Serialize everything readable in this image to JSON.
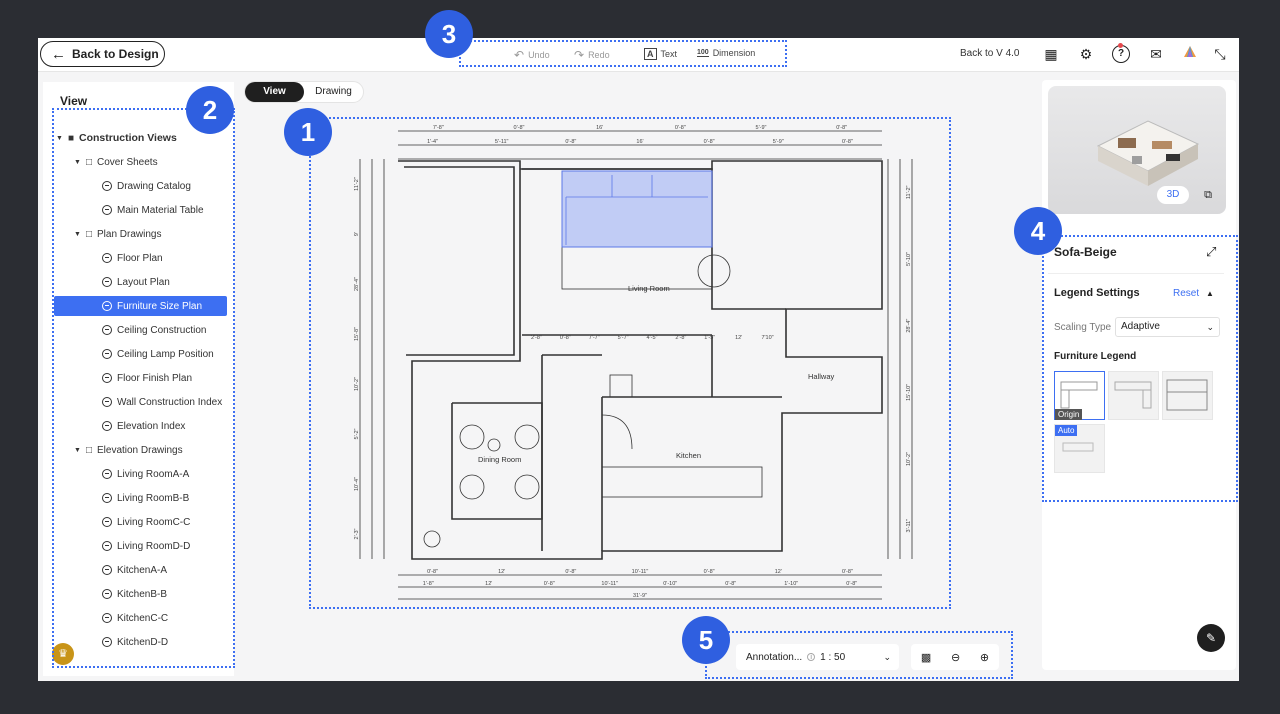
{
  "topbar": {
    "back_label": "Back to Design",
    "undo": "Undo",
    "redo": "Redo",
    "text": "Text",
    "dimension": "Dimension",
    "dimension_glyph": "100",
    "back_version": "Back to V 4.0"
  },
  "left_panel": {
    "title": "View",
    "tree": [
      {
        "label": "Construction Views",
        "level": 0,
        "kind": "root"
      },
      {
        "label": "Cover Sheets",
        "level": 1,
        "kind": "folder"
      },
      {
        "label": "Drawing Catalog",
        "level": 2,
        "kind": "leaf"
      },
      {
        "label": "Main Material Table",
        "level": 2,
        "kind": "leaf"
      },
      {
        "label": "Plan Drawings",
        "level": 1,
        "kind": "folder"
      },
      {
        "label": "Floor Plan",
        "level": 2,
        "kind": "leaf"
      },
      {
        "label": "Layout Plan",
        "level": 2,
        "kind": "leaf"
      },
      {
        "label": "Furniture Size Plan",
        "level": 2,
        "kind": "leaf",
        "selected": true
      },
      {
        "label": "Ceiling Construction",
        "level": 2,
        "kind": "leaf"
      },
      {
        "label": "Ceiling Lamp Position",
        "level": 2,
        "kind": "leaf"
      },
      {
        "label": "Floor Finish Plan",
        "level": 2,
        "kind": "leaf"
      },
      {
        "label": "Wall Construction Index",
        "level": 2,
        "kind": "leaf"
      },
      {
        "label": "Elevation Index",
        "level": 2,
        "kind": "leaf"
      },
      {
        "label": "Elevation Drawings",
        "level": 1,
        "kind": "folder"
      },
      {
        "label": "Living RoomA-A",
        "level": 2,
        "kind": "leaf"
      },
      {
        "label": "Living RoomB-B",
        "level": 2,
        "kind": "leaf"
      },
      {
        "label": "Living RoomC-C",
        "level": 2,
        "kind": "leaf"
      },
      {
        "label": "Living RoomD-D",
        "level": 2,
        "kind": "leaf"
      },
      {
        "label": "KitchenA-A",
        "level": 2,
        "kind": "leaf"
      },
      {
        "label": "KitchenB-B",
        "level": 2,
        "kind": "leaf"
      },
      {
        "label": "KitchenC-C",
        "level": 2,
        "kind": "leaf"
      },
      {
        "label": "KitchenD-D",
        "level": 2,
        "kind": "leaf"
      }
    ]
  },
  "toggle": {
    "view": "View",
    "drawing": "Drawing"
  },
  "floorplan": {
    "rooms": {
      "living": "Living Room",
      "hallway": "Hallway",
      "dining": "Dining Room",
      "kitchen": "Kitchen"
    },
    "dims_top": [
      "7'-8\"",
      "0'-8\"",
      "16'",
      "0'-8\"",
      "5'-9\"",
      "0'-8\""
    ],
    "dims_top2": [
      "1'-4\"",
      "5'-11\"",
      "0'-8\"",
      "16'",
      "0'-8\"",
      "5'-9\"",
      "0'-8\""
    ],
    "dims_bottom": [
      "0'-8\"",
      "12'",
      "0'-8\"",
      "10'-11\"",
      "0'-8\"",
      "12'",
      "0'-8\""
    ],
    "dims_bottom2": [
      "1'-8\"",
      "12'",
      "0'-8\"",
      "10'-11\"",
      "0'-10\"",
      "0'-8\"",
      "1'-10\"",
      "0'-8\""
    ],
    "dim_total_bottom": "31'-9\"",
    "dims_inner": [
      "2'-8\"",
      "0'-8\"",
      "7'-7\"",
      "5'-7\"",
      "4'-5\"",
      "2'-8\"",
      "1'-5\"",
      "12'",
      "7'10\""
    ],
    "dims_left": [
      "11'-2\"",
      "9'",
      "28'-4\"",
      "15'-8\"",
      "10'-2\"",
      "5'-2\"",
      "10'-4\"",
      "2'-3\""
    ],
    "dims_right": [
      "11'-2\"",
      "5'-10\"",
      "28'-4\"",
      "15'-10\"",
      "10'-2\"",
      "3'-11\""
    ]
  },
  "preview": {
    "btn3d": "3D"
  },
  "right_panel": {
    "title": "Sofa-Beige",
    "legend_title": "Legend Settings",
    "reset": "Reset",
    "scaling_label": "Scaling Type",
    "scaling_value": "Adaptive",
    "furniture_legend": "Furniture Legend",
    "tag_origin": "Origin",
    "tag_auto": "Auto"
  },
  "bottom": {
    "annotation_label": "Annotation...",
    "info_glyph": "i",
    "scale": "1 : 50"
  },
  "badges": [
    "1",
    "2",
    "3",
    "4",
    "5"
  ],
  "colors": {
    "accent": "#3d6ff2",
    "badge": "#2f5fe0",
    "backdrop": "#2b2d33",
    "selection": "#9fb1f5"
  },
  "icons": [
    "back-arrow-icon",
    "undo-icon",
    "redo-icon",
    "text-icon",
    "dimension-icon",
    "preview-icon",
    "settings-icon",
    "help-icon",
    "mail-icon",
    "color-icon",
    "shrink-icon",
    "folder-icon",
    "expand-icon",
    "copy-icon",
    "chat-icon",
    "fit-icon",
    "zoom-out-icon",
    "zoom-in-icon",
    "crown-icon"
  ]
}
